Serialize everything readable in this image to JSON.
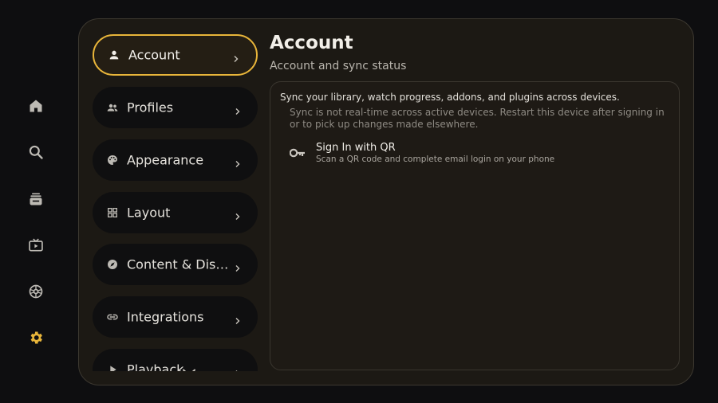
{
  "colors": {
    "accent": "#e8b53a",
    "icon": "#bdbab4"
  },
  "rail": {
    "items": [
      {
        "icon": "home-icon"
      },
      {
        "icon": "search-icon"
      },
      {
        "icon": "library-icon"
      },
      {
        "icon": "live-tv-icon"
      },
      {
        "icon": "addons-icon"
      },
      {
        "icon": "gear-icon",
        "active": true
      }
    ]
  },
  "categories": {
    "items": [
      {
        "label": "Account",
        "icon": "person-icon",
        "active": true
      },
      {
        "label": "Profiles",
        "icon": "people-icon"
      },
      {
        "label": "Appearance",
        "icon": "palette-icon"
      },
      {
        "label": "Layout",
        "icon": "grid-icon"
      },
      {
        "label": "Content & Disco...",
        "icon": "compass-icon"
      },
      {
        "label": "Integrations",
        "icon": "link-icon"
      },
      {
        "label": "Playback",
        "icon": "play-icon"
      }
    ]
  },
  "detail": {
    "title": "Account",
    "subtitle": "Account and sync status",
    "sync_text": "Sync your library, watch progress, addons, and plugins across devices.",
    "sync_note": "Sync is not real-time across active devices. Restart this device after signing in or to pick up changes made elsewhere.",
    "signin": {
      "title": "Sign In with QR",
      "description": "Scan a QR code and complete email login on your phone",
      "icon": "key-icon"
    }
  }
}
